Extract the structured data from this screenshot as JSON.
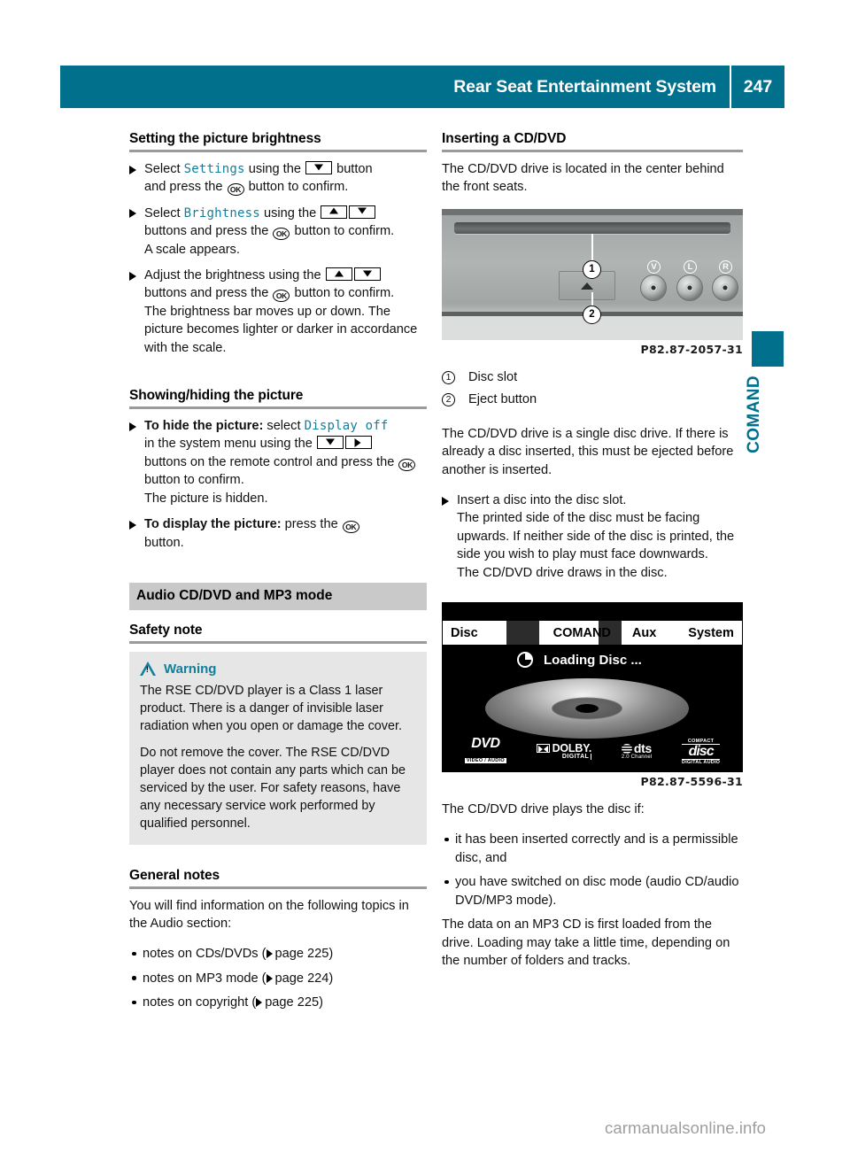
{
  "header": {
    "title": "Rear Seat Entertainment System",
    "page_number": "247"
  },
  "edge_tab": {
    "label": "COMAND",
    "marker_color": "#00708c"
  },
  "left_column": {
    "section_brightness": {
      "heading": "Setting the picture brightness",
      "steps": [
        {
          "parts": [
            "Select ",
            "Settings",
            " using the ",
            "[down]",
            " button and press the ",
            "[ok]",
            " button to confirm."
          ]
        },
        {
          "parts": [
            "Select ",
            "Brightness",
            " using the ",
            "[up]",
            "[down]",
            " buttons and press the ",
            "[ok]",
            " button to confirm.",
            "A scale appears."
          ]
        },
        {
          "parts": [
            "Adjust the brightness using the ",
            "[up]",
            "[down]",
            " buttons and press the ",
            "[ok]",
            " button to confirm.",
            "The brightness bar moves up or down. The picture becomes lighter or darker in accordance with the scale."
          ]
        }
      ],
      "step1_lead": "Select",
      "step1_menuword": "Settings",
      "step1_mid": "using the",
      "step1_tail": "button",
      "step1_line2a": "and press the",
      "step1_line2b": "button to confirm.",
      "step2_lead": "Select",
      "step2_menuword": "Brightness",
      "step2_mid": "using the",
      "step2_line2a": "buttons and press the",
      "step2_line2b": "button to confirm.",
      "step2_line3": "A scale appears.",
      "step3_lead": "Adjust the brightness using the",
      "step3_line2a": "buttons and press the",
      "step3_line2b": "button to confirm.",
      "step3_line3": "The brightness bar moves up or down. The picture becomes lighter or darker in accordance with the scale."
    },
    "section_showhide": {
      "heading": "Showing/hiding the picture",
      "step1_bold": "To hide the picture:",
      "step1_a": "select",
      "step1_menuword": "Display off",
      "step1_b": "in the system menu using the",
      "step1_c": "buttons on the remote control and press the",
      "step1_d": "button to confirm.",
      "step1_result": "The picture is hidden.",
      "step2_bold": "To display the picture:",
      "step2_a": "press the",
      "step2_b": "button."
    },
    "section_audio": {
      "band_title": "Audio CD/DVD and MP3 mode",
      "safety_heading": "Safety note",
      "warning_title": "Warning",
      "warning_icon": "warning-triangle-icon",
      "warning_p1": "The RSE CD/DVD player is a Class 1 laser product. There is a danger of invisible laser radiation when you open or damage the cover.",
      "warning_p2": "Do not remove the cover. The RSE CD/DVD player does not contain any parts which can be serviced by the user. For safety reasons, have any necessary service work performed by qualified personnel."
    },
    "section_general": {
      "heading": "General notes",
      "intro": "You will find information on the following topics in the Audio section:",
      "bullets": [
        {
          "text": "notes on CDs/DVDs",
          "ref": "page 225"
        },
        {
          "text": "notes on MP3 mode",
          "ref": "page 224"
        },
        {
          "text": "notes on copyright",
          "ref": "page 225"
        }
      ]
    }
  },
  "right_column": {
    "section_insert": {
      "heading": "Inserting a CD/DVD",
      "intro": "The CD/DVD drive is located in the center behind the front seats."
    },
    "figure_drive": {
      "name": "cd-dvd-drive-photo",
      "caption": "P82.87-2057-31",
      "callout_1": "1",
      "callout_2": "2",
      "jack_labels": [
        "V",
        "L",
        "R"
      ],
      "legend": [
        {
          "num": "1",
          "label": "Disc slot"
        },
        {
          "num": "2",
          "label": "Eject button"
        }
      ]
    },
    "after_figure": {
      "p1": "The CD/DVD drive is a single disc drive. If there is already a disc inserted, this must be ejected before another is inserted.",
      "step1": "Insert a disc into the disc slot.",
      "step1_result1": "The printed side of the disc must be facing upwards. If neither side of the disc is printed, the side you wish to play must face downwards.",
      "step1_result2": "The CD/DVD drive draws in the disc."
    },
    "figure_screen": {
      "name": "comand-loading-screen",
      "caption": "P82.87-5596-31",
      "tabs": [
        "Disc",
        "COMAND",
        "Aux",
        "System"
      ],
      "status_text": "Loading Disc ...",
      "logos": [
        {
          "main": "DVD",
          "sub": "VIDEO / AUDIO"
        },
        {
          "main": "DOLBY.",
          "sub": "DIGITAL"
        },
        {
          "main": "dts",
          "sub": "2.0 Channel"
        },
        {
          "top": "COMPACT",
          "main": "disc",
          "sub": "DIGITAL AUDIO"
        }
      ]
    },
    "after_screen": {
      "intro": "The CD/DVD drive plays the disc if:",
      "bullets": [
        "it has been inserted correctly and is a permissible disc, and",
        "you have switched on disc mode (audio CD/audio DVD/MP3 mode)."
      ],
      "closing": "The data on an MP3 CD is first loaded from the drive. Loading may take a little time, depending on the number of folders and tracks."
    }
  },
  "watermark": "carmanualsonline.info"
}
